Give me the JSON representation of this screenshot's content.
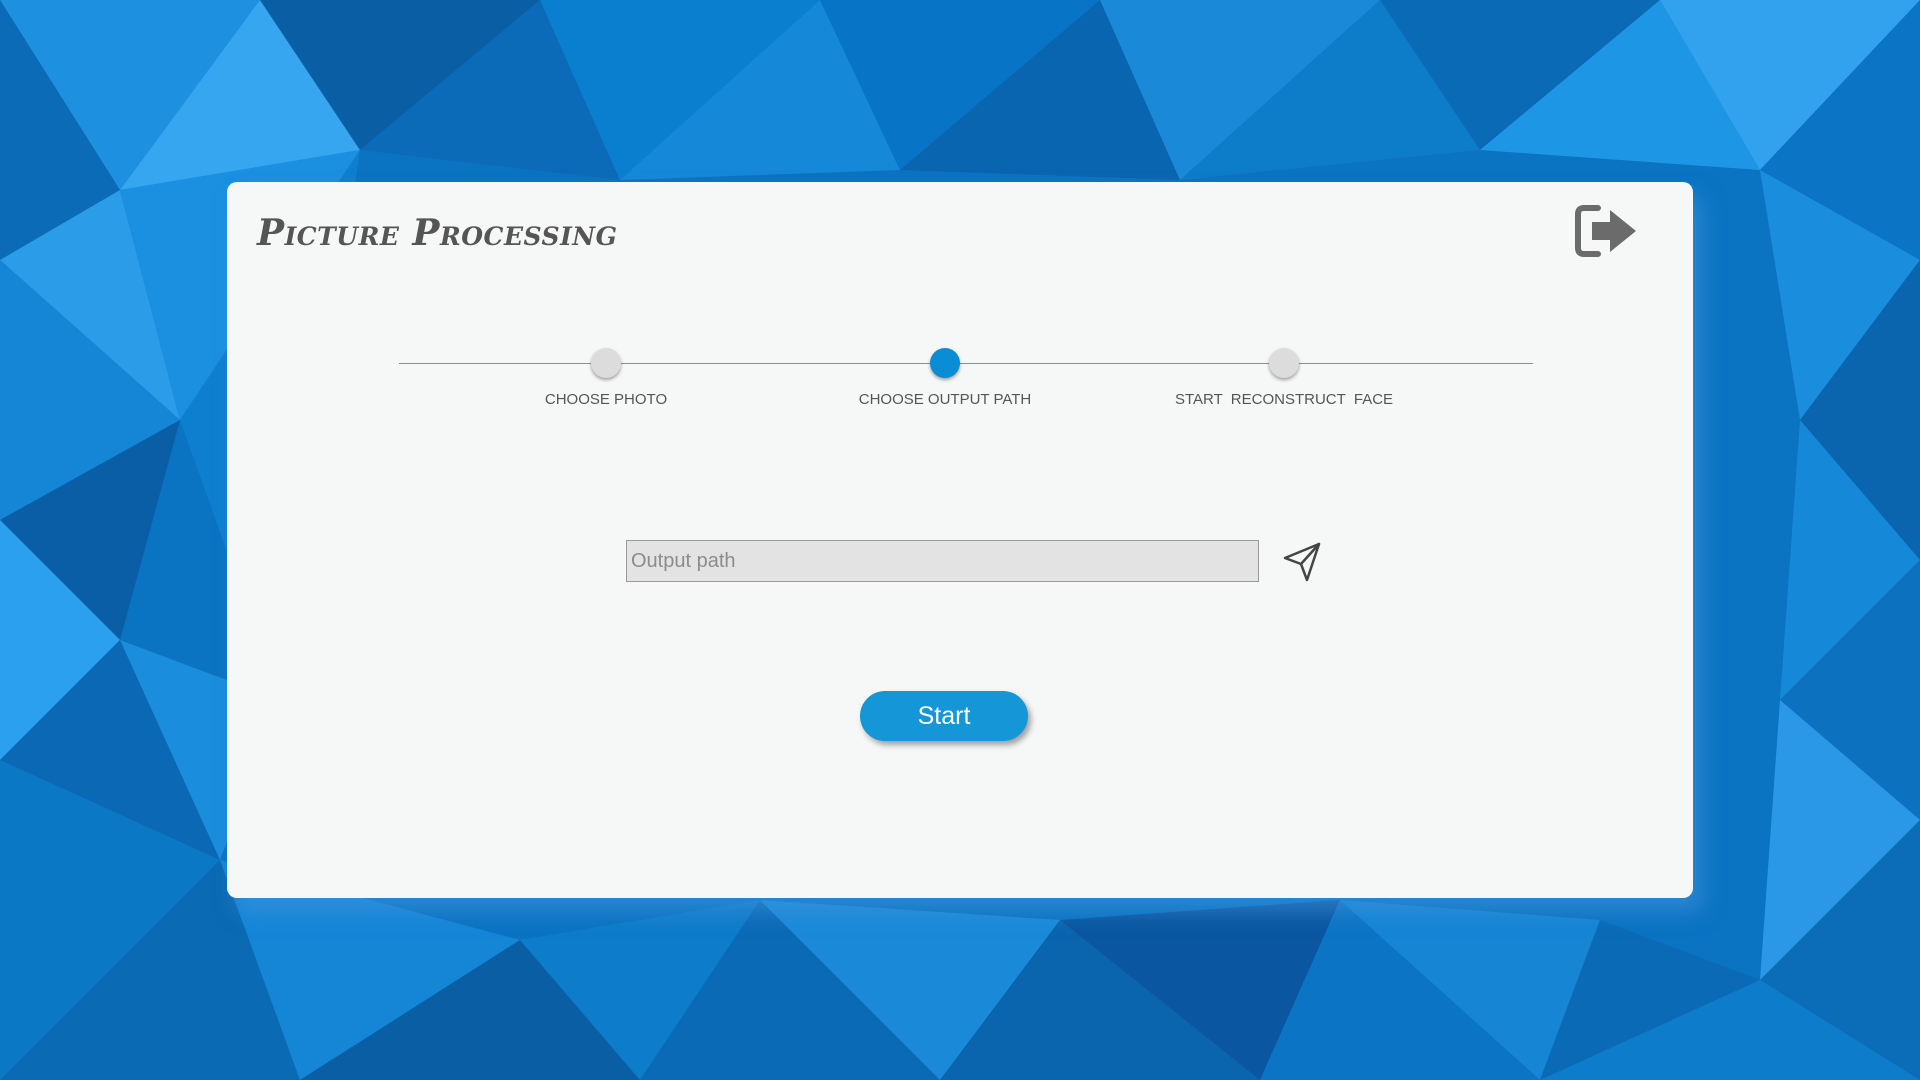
{
  "app": {
    "title": "Picture Processing"
  },
  "stepper": {
    "steps": [
      {
        "label": "CHOOSE PHOTO",
        "active": false
      },
      {
        "label": "CHOOSE OUTPUT PATH",
        "active": true
      },
      {
        "label": "START  RECONSTRUCT  FACE",
        "active": false
      }
    ]
  },
  "output": {
    "placeholder": "Output path",
    "value": ""
  },
  "actions": {
    "start_label": "Start"
  },
  "icons": {
    "exit": "exit-arrow-icon",
    "send": "send-icon"
  },
  "colors": {
    "accent": "#1596d6",
    "active_step": "#0b8dd6",
    "inactive_step": "#dcdcdc",
    "panel": "#f6f7f7",
    "title": "#555555"
  }
}
